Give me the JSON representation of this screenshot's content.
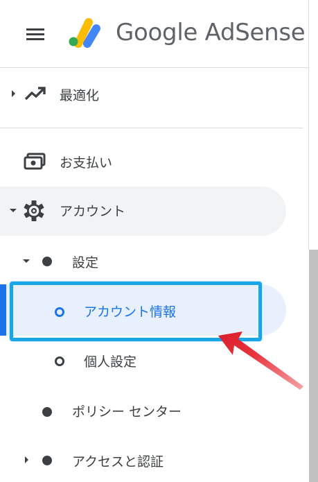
{
  "header": {
    "brand": "Google AdSense",
    "menu_icon": "hamburger-menu-icon",
    "logo_icon": "adsense-logo-icon"
  },
  "nav": {
    "optimization": {
      "label": "最適化",
      "icon": "trending-up-icon"
    },
    "payments": {
      "label": "お支払い",
      "icon": "payments-icon"
    },
    "account": {
      "label": "アカウント",
      "icon": "gear-icon"
    },
    "settings": {
      "label": "設定"
    },
    "account_info": {
      "label": "アカウント情報"
    },
    "personal_settings": {
      "label": "個人設定"
    },
    "policy_center": {
      "label": "ポリシー センター"
    },
    "access_auth": {
      "label": "アクセスと認証"
    }
  },
  "colors": {
    "accent": "#1a73e8",
    "selected_bg": "#e8f0fe",
    "hover_bg": "#f1f3f4",
    "annotation_box": "#18a6e6",
    "annotation_arrow": "#e8323c"
  }
}
